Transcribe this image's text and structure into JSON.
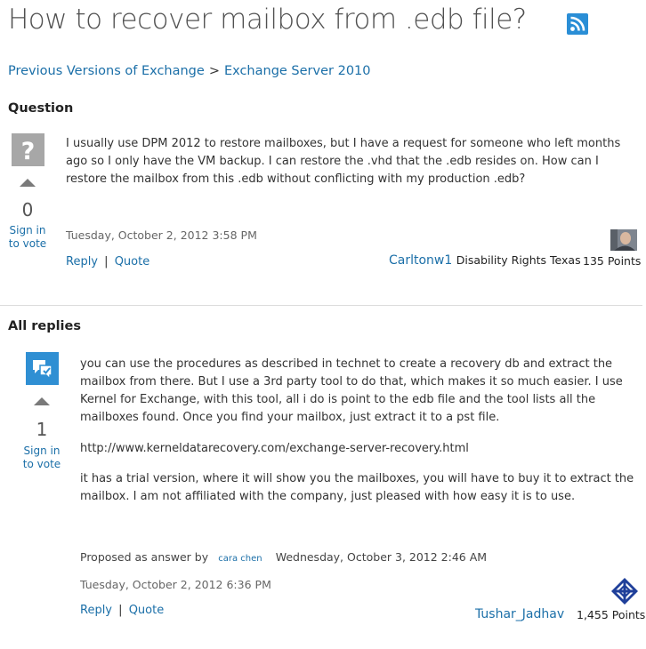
{
  "page": {
    "title": "How to recover mailbox from .edb file?"
  },
  "breadcrumb": {
    "item1": "Previous Versions of Exchange",
    "separator": ">",
    "item2": "Exchange Server 2010"
  },
  "question": {
    "heading": "Question",
    "vote_count": "0",
    "sign_in_line1": "Sign in",
    "sign_in_line2": "to vote",
    "body": "I usually use DPM 2012 to restore mailboxes, but I have a request for someone who left months ago so I only have the VM backup. I can restore the .vhd that the .edb resides on. How can I restore the mailbox from this .edb without conflicting with my production .edb?",
    "timestamp": "Tuesday, October 2, 2012 3:58 PM",
    "reply_label": "Reply",
    "action_separator": "|",
    "quote_label": "Quote",
    "author": "Carltonw1",
    "affiliation": "Disability Rights Texas",
    "points": "135 Points"
  },
  "replies": {
    "heading": "All replies",
    "items": [
      {
        "vote_count": "1",
        "sign_in_line1": "Sign in",
        "sign_in_line2": "to vote",
        "paragraph1": "you can use the procedures as described in technet to create a recovery db and extract the mailbox from there. But I use a 3rd party tool to do that, which makes it so much easier. I use Kernel for Exchange, with this tool, all i do is point to the edb file and the tool lists all the mailboxes found. Once you find your mailbox, just extract it to a pst file.",
        "paragraph2": "http://www.kerneldatarecovery.com/exchange-server-recovery.html",
        "paragraph3": "it has a trial version, where it will show you the mailboxes, you will have to buy it to extract the mailbox. I am not affiliated with the company, just pleased with how easy it is to use.",
        "proposed_label": "Proposed as answer by",
        "proposed_by": "cara chen",
        "proposed_date": "Wednesday, October 3, 2012 2:46 AM",
        "timestamp": "Tuesday, October 2, 2012 6:36 PM",
        "reply_label": "Reply",
        "action_separator": "|",
        "quote_label": "Quote",
        "author": "Tushar_Jadhav",
        "points": "1,455 Points"
      }
    ]
  },
  "colors": {
    "link": "#1b6fa8",
    "rss": "#2a8ed6",
    "reply_icon": "#2f8fd3",
    "gray_icon": "#a7a7a7"
  },
  "icons": [
    "rss-icon",
    "question-mark-icon",
    "reply-speech-icon",
    "up-arrow-icon",
    "user-avatar",
    "community-badge-icon"
  ]
}
